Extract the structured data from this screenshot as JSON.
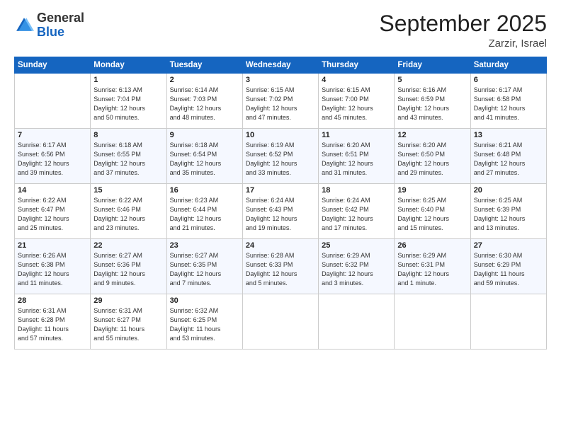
{
  "header": {
    "logo_general": "General",
    "logo_blue": "Blue",
    "month_title": "September 2025",
    "location": "Zarzir, Israel"
  },
  "days_of_week": [
    "Sunday",
    "Monday",
    "Tuesday",
    "Wednesday",
    "Thursday",
    "Friday",
    "Saturday"
  ],
  "weeks": [
    [
      {
        "day": "",
        "info": ""
      },
      {
        "day": "1",
        "info": "Sunrise: 6:13 AM\nSunset: 7:04 PM\nDaylight: 12 hours\nand 50 minutes."
      },
      {
        "day": "2",
        "info": "Sunrise: 6:14 AM\nSunset: 7:03 PM\nDaylight: 12 hours\nand 48 minutes."
      },
      {
        "day": "3",
        "info": "Sunrise: 6:15 AM\nSunset: 7:02 PM\nDaylight: 12 hours\nand 47 minutes."
      },
      {
        "day": "4",
        "info": "Sunrise: 6:15 AM\nSunset: 7:00 PM\nDaylight: 12 hours\nand 45 minutes."
      },
      {
        "day": "5",
        "info": "Sunrise: 6:16 AM\nSunset: 6:59 PM\nDaylight: 12 hours\nand 43 minutes."
      },
      {
        "day": "6",
        "info": "Sunrise: 6:17 AM\nSunset: 6:58 PM\nDaylight: 12 hours\nand 41 minutes."
      }
    ],
    [
      {
        "day": "7",
        "info": "Sunrise: 6:17 AM\nSunset: 6:56 PM\nDaylight: 12 hours\nand 39 minutes."
      },
      {
        "day": "8",
        "info": "Sunrise: 6:18 AM\nSunset: 6:55 PM\nDaylight: 12 hours\nand 37 minutes."
      },
      {
        "day": "9",
        "info": "Sunrise: 6:18 AM\nSunset: 6:54 PM\nDaylight: 12 hours\nand 35 minutes."
      },
      {
        "day": "10",
        "info": "Sunrise: 6:19 AM\nSunset: 6:52 PM\nDaylight: 12 hours\nand 33 minutes."
      },
      {
        "day": "11",
        "info": "Sunrise: 6:20 AM\nSunset: 6:51 PM\nDaylight: 12 hours\nand 31 minutes."
      },
      {
        "day": "12",
        "info": "Sunrise: 6:20 AM\nSunset: 6:50 PM\nDaylight: 12 hours\nand 29 minutes."
      },
      {
        "day": "13",
        "info": "Sunrise: 6:21 AM\nSunset: 6:48 PM\nDaylight: 12 hours\nand 27 minutes."
      }
    ],
    [
      {
        "day": "14",
        "info": "Sunrise: 6:22 AM\nSunset: 6:47 PM\nDaylight: 12 hours\nand 25 minutes."
      },
      {
        "day": "15",
        "info": "Sunrise: 6:22 AM\nSunset: 6:46 PM\nDaylight: 12 hours\nand 23 minutes."
      },
      {
        "day": "16",
        "info": "Sunrise: 6:23 AM\nSunset: 6:44 PM\nDaylight: 12 hours\nand 21 minutes."
      },
      {
        "day": "17",
        "info": "Sunrise: 6:24 AM\nSunset: 6:43 PM\nDaylight: 12 hours\nand 19 minutes."
      },
      {
        "day": "18",
        "info": "Sunrise: 6:24 AM\nSunset: 6:42 PM\nDaylight: 12 hours\nand 17 minutes."
      },
      {
        "day": "19",
        "info": "Sunrise: 6:25 AM\nSunset: 6:40 PM\nDaylight: 12 hours\nand 15 minutes."
      },
      {
        "day": "20",
        "info": "Sunrise: 6:25 AM\nSunset: 6:39 PM\nDaylight: 12 hours\nand 13 minutes."
      }
    ],
    [
      {
        "day": "21",
        "info": "Sunrise: 6:26 AM\nSunset: 6:38 PM\nDaylight: 12 hours\nand 11 minutes."
      },
      {
        "day": "22",
        "info": "Sunrise: 6:27 AM\nSunset: 6:36 PM\nDaylight: 12 hours\nand 9 minutes."
      },
      {
        "day": "23",
        "info": "Sunrise: 6:27 AM\nSunset: 6:35 PM\nDaylight: 12 hours\nand 7 minutes."
      },
      {
        "day": "24",
        "info": "Sunrise: 6:28 AM\nSunset: 6:33 PM\nDaylight: 12 hours\nand 5 minutes."
      },
      {
        "day": "25",
        "info": "Sunrise: 6:29 AM\nSunset: 6:32 PM\nDaylight: 12 hours\nand 3 minutes."
      },
      {
        "day": "26",
        "info": "Sunrise: 6:29 AM\nSunset: 6:31 PM\nDaylight: 12 hours\nand 1 minute."
      },
      {
        "day": "27",
        "info": "Sunrise: 6:30 AM\nSunset: 6:29 PM\nDaylight: 11 hours\nand 59 minutes."
      }
    ],
    [
      {
        "day": "28",
        "info": "Sunrise: 6:31 AM\nSunset: 6:28 PM\nDaylight: 11 hours\nand 57 minutes."
      },
      {
        "day": "29",
        "info": "Sunrise: 6:31 AM\nSunset: 6:27 PM\nDaylight: 11 hours\nand 55 minutes."
      },
      {
        "day": "30",
        "info": "Sunrise: 6:32 AM\nSunset: 6:25 PM\nDaylight: 11 hours\nand 53 minutes."
      },
      {
        "day": "",
        "info": ""
      },
      {
        "day": "",
        "info": ""
      },
      {
        "day": "",
        "info": ""
      },
      {
        "day": "",
        "info": ""
      }
    ]
  ]
}
